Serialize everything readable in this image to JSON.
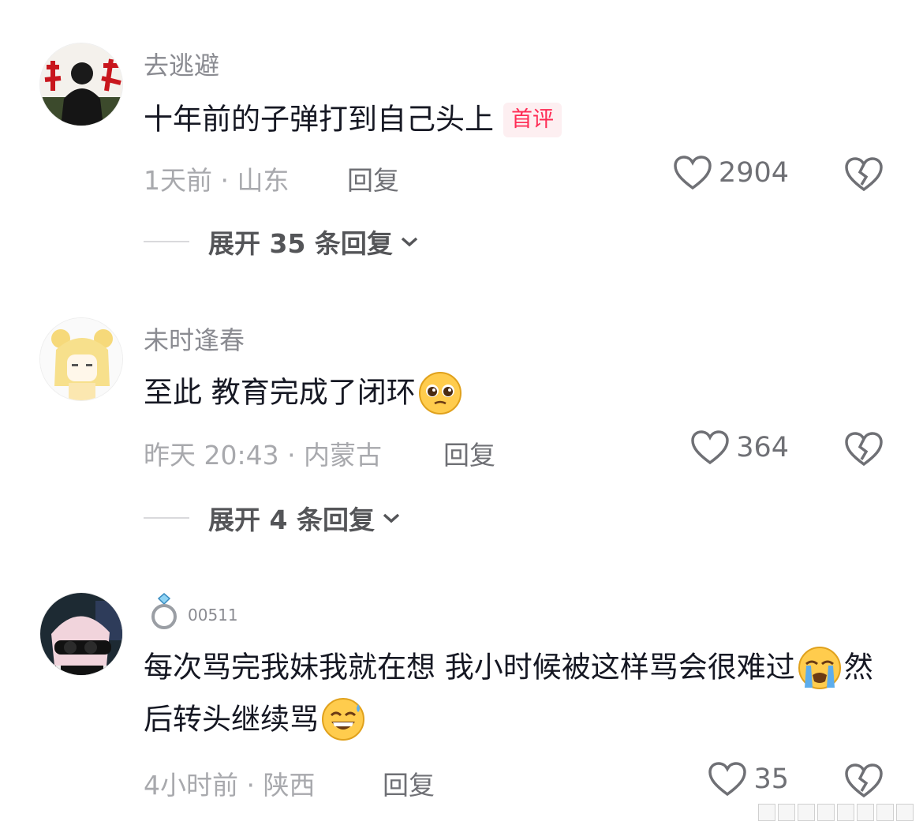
{
  "comments": [
    {
      "username": "去逃避",
      "text": "十年前的子弹打到自己头上",
      "badge": "首评",
      "time_location": "1天前 · 山东",
      "reply_label": "回复",
      "likes": "2904",
      "expand_label": "展开 35 条回复"
    },
    {
      "username": "未时逢春",
      "text": "至此 教育完成了闭环",
      "emoji": "pleading-face-emoji",
      "time_location": "昨天 20:43 · 内蒙古",
      "reply_label": "回复",
      "likes": "364",
      "expand_label": "展开 4 条回复"
    },
    {
      "username": "00511",
      "username_icon": "ring-icon",
      "text_part1": "每次骂完我妹我就在想  我小时候被这样骂会很难过",
      "emoji1": "loudly-crying-face-emoji",
      "text_part2": "然后转头继续骂",
      "emoji2": "grinning-sweat-face-emoji",
      "time_location": "4小时前 · 陕西",
      "reply_label": "回复",
      "likes": "35"
    }
  ],
  "colors": {
    "accent": "#fe2c55",
    "text_primary": "#161823",
    "text_secondary": "#8a8b91"
  }
}
